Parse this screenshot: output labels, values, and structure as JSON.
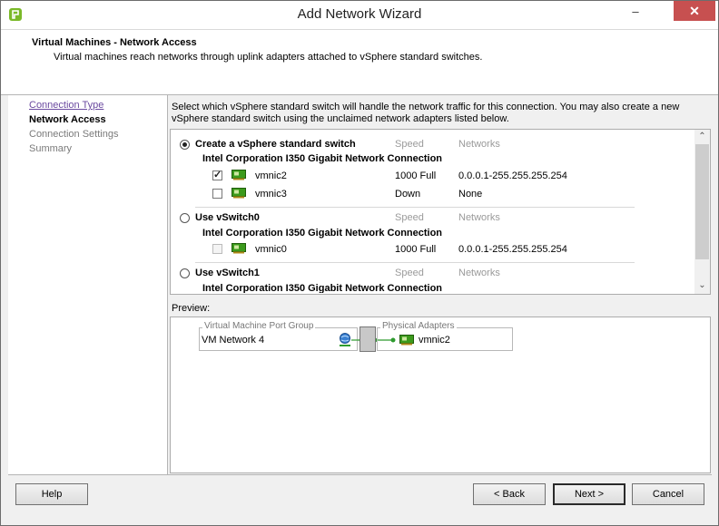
{
  "window": {
    "title": "Add Network Wizard",
    "minimize_glyph": "–",
    "close_glyph": "✕"
  },
  "header": {
    "title": "Virtual Machines - Network Access",
    "description": "Virtual machines reach networks through uplink adapters attached to vSphere standard switches."
  },
  "nav": {
    "items": [
      {
        "label": "Connection Type",
        "state": "link"
      },
      {
        "label": "Network Access",
        "state": "current"
      },
      {
        "label": "Connection Settings",
        "state": "pending"
      },
      {
        "label": "Summary",
        "state": "pending"
      }
    ]
  },
  "instructions": "Select which vSphere standard switch will handle the network traffic for this connection. You may also create a new vSphere standard switch using the unclaimed network adapters listed below.",
  "switch_options": [
    {
      "label": "Create a vSphere standard switch",
      "selected": true,
      "speed_header": "Speed",
      "networks_header": "Networks",
      "adapter_group": "Intel Corporation I350 Gigabit Network Connection",
      "nics": [
        {
          "name": "vmnic2",
          "checked": true,
          "enabled": true,
          "speed": "1000 Full",
          "networks": "0.0.0.1-255.255.255.254"
        },
        {
          "name": "vmnic3",
          "checked": false,
          "enabled": true,
          "speed": "Down",
          "networks": "None"
        }
      ]
    },
    {
      "label": "Use vSwitch0",
      "selected": false,
      "speed_header": "Speed",
      "networks_header": "Networks",
      "adapter_group": "Intel Corporation I350 Gigabit Network Connection",
      "nics": [
        {
          "name": "vmnic0",
          "checked": false,
          "enabled": false,
          "speed": "1000 Full",
          "networks": "0.0.0.1-255.255.255.254"
        }
      ]
    },
    {
      "label": "Use vSwitch1",
      "selected": false,
      "speed_header": "Speed",
      "networks_header": "Networks",
      "adapter_group": "Intel Corporation I350 Gigabit Network Connection",
      "nics": []
    }
  ],
  "scrollbar": {
    "up_glyph": "⌃",
    "down_glyph": "⌄"
  },
  "preview": {
    "label": "Preview:",
    "port_group_legend": "Virtual Machine Port Group",
    "port_group_name": "VM Network 4",
    "adapters_legend": "Physical Adapters",
    "adapter_name": "vmnic2"
  },
  "buttons": {
    "help": "Help",
    "back": "< Back",
    "next": "Next >",
    "cancel": "Cancel"
  },
  "colors": {
    "close_red": "#c75050",
    "link_purple": "#6b4aa0",
    "nic_green": "#3c9a1c",
    "link_green": "#2e9b2e"
  }
}
